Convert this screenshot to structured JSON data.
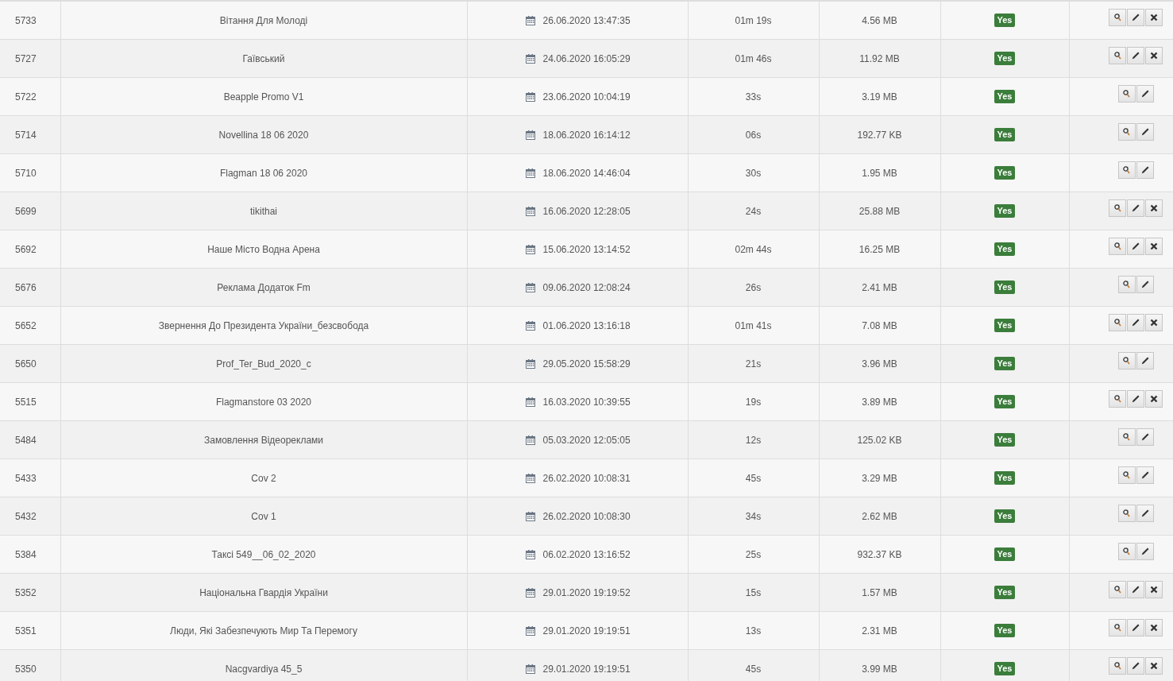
{
  "table": {
    "rows": [
      {
        "id": "5733",
        "name": "Вітання Для Молоді",
        "date": "26.06.2020 13:47:35",
        "duration": "01m 19s",
        "size": "4.56 MB",
        "status": "Yes",
        "deletable": true
      },
      {
        "id": "5727",
        "name": "Гаївський",
        "date": "24.06.2020 16:05:29",
        "duration": "01m 46s",
        "size": "11.92 MB",
        "status": "Yes",
        "deletable": true
      },
      {
        "id": "5722",
        "name": "Beapple Promo V1",
        "date": "23.06.2020 10:04:19",
        "duration": "33s",
        "size": "3.19 MB",
        "status": "Yes",
        "deletable": false
      },
      {
        "id": "5714",
        "name": "Novellina 18 06 2020",
        "date": "18.06.2020 16:14:12",
        "duration": "06s",
        "size": "192.77 KB",
        "status": "Yes",
        "deletable": false
      },
      {
        "id": "5710",
        "name": "Flagman 18 06 2020",
        "date": "18.06.2020 14:46:04",
        "duration": "30s",
        "size": "1.95 MB",
        "status": "Yes",
        "deletable": false
      },
      {
        "id": "5699",
        "name": "tikithai",
        "date": "16.06.2020 12:28:05",
        "duration": "24s",
        "size": "25.88 MB",
        "status": "Yes",
        "deletable": true
      },
      {
        "id": "5692",
        "name": "Наше Місто Водна Арена",
        "date": "15.06.2020 13:14:52",
        "duration": "02m 44s",
        "size": "16.25 MB",
        "status": "Yes",
        "deletable": true
      },
      {
        "id": "5676",
        "name": "Реклама Додаток Fm",
        "date": "09.06.2020 12:08:24",
        "duration": "26s",
        "size": "2.41 MB",
        "status": "Yes",
        "deletable": false
      },
      {
        "id": "5652",
        "name": "Звернення До Президента України_безсвобода",
        "date": "01.06.2020 13:16:18",
        "duration": "01m 41s",
        "size": "7.08 MB",
        "status": "Yes",
        "deletable": true
      },
      {
        "id": "5650",
        "name": "Prof_Ter_Bud_2020_c",
        "date": "29.05.2020 15:58:29",
        "duration": "21s",
        "size": "3.96 MB",
        "status": "Yes",
        "deletable": false
      },
      {
        "id": "5515",
        "name": "Flagmanstore 03 2020",
        "date": "16.03.2020 10:39:55",
        "duration": "19s",
        "size": "3.89 MB",
        "status": "Yes",
        "deletable": true
      },
      {
        "id": "5484",
        "name": "Замовлення Відеореклами",
        "date": "05.03.2020 12:05:05",
        "duration": "12s",
        "size": "125.02 KB",
        "status": "Yes",
        "deletable": false
      },
      {
        "id": "5433",
        "name": "Cov 2",
        "date": "26.02.2020 10:08:31",
        "duration": "45s",
        "size": "3.29 MB",
        "status": "Yes",
        "deletable": false
      },
      {
        "id": "5432",
        "name": "Cov 1",
        "date": "26.02.2020 10:08:30",
        "duration": "34s",
        "size": "2.62 MB",
        "status": "Yes",
        "deletable": false
      },
      {
        "id": "5384",
        "name": "Таксі 549__06_02_2020",
        "date": "06.02.2020 13:16:52",
        "duration": "25s",
        "size": "932.37 KB",
        "status": "Yes",
        "deletable": false
      },
      {
        "id": "5352",
        "name": "Національна Гвардія України",
        "date": "29.01.2020 19:19:52",
        "duration": "15s",
        "size": "1.57 MB",
        "status": "Yes",
        "deletable": true
      },
      {
        "id": "5351",
        "name": "Люди, Які Забезпечують Мир Та Перемогу",
        "date": "29.01.2020 19:19:51",
        "duration": "13s",
        "size": "2.31 MB",
        "status": "Yes",
        "deletable": true
      },
      {
        "id": "5350",
        "name": "Nacgvardiya 45_5",
        "date": "29.01.2020 19:19:51",
        "duration": "45s",
        "size": "3.99 MB",
        "status": "Yes",
        "deletable": true
      }
    ]
  }
}
